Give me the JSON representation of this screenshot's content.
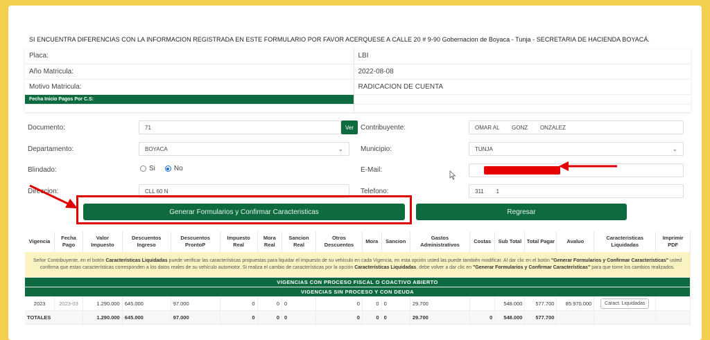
{
  "notice": "SI ENCUENTRA DIFERENCIAS CON LA INFORMACION REGISTRADA EN ESTE FORMULARIO POR FAVOR ACERQUESE A CALLE 20 # 9-90 Gobernacion de Boyaca - Tunja - SECRETARIA DE HACIENDA BOYACÁ.",
  "info": {
    "placa_label": "Placa:",
    "placa_value": "LBI",
    "anio_label": "Año Matricula:",
    "anio_value": "2022-08-08",
    "motivo_label": "Motivo Matricula:",
    "motivo_value": "RADICACION DE CUENTA",
    "fecha_label": "Fecha Inicio Pagos Por C.S:"
  },
  "form": {
    "documento_label": "Documento:",
    "documento_value": "71",
    "ver_label": "Ver",
    "contribuyente_label": "Contribuyente:",
    "contribuyente_value": "OMAR AL        GONZ        ONZALEZ",
    "departamento_label": "Departamento:",
    "departamento_value": "BOYACA",
    "municipio_label": "Municipio:",
    "municipio_value": "TUNJA",
    "blindado_label": "Blindado:",
    "si_label": "Si",
    "no_label": "No",
    "email_label": "E-Mail:",
    "direccion_label": "Direccion:",
    "direccion_value": "CLL 60 N",
    "telefono_label": "Telefono:",
    "telefono_value": "311        1"
  },
  "buttons": {
    "generar": "Generar Formularios y Confirmar Caracteristicas",
    "regresar": "Regresar"
  },
  "table": {
    "headers": [
      "Vigencia",
      "Fecha Pago",
      "Valor Impuesto",
      "Descuentos Ingreso",
      "Descuentos ProntoP",
      "Impuesto Real",
      "Mora Real",
      "Sancion Real",
      "Otros Descuentos",
      "Mora",
      "Sancion",
      "Gastos Administrativos",
      "Costas",
      "Sub Total",
      "Total Pagar",
      "Avaluo",
      "Caracteristicas Liquidadas",
      "Imprimir PDF"
    ],
    "warn_1": "Señor Contribuyente, en el botón ",
    "warn_b1": "Características Liquidadas",
    "warn_2": " puede verificar las características propuestas para liquidar el impuesto de su vehículo en cada Vigencia, en esta opción usted las puede también modificar. Al dar clic en el botón ",
    "warn_b2": "\"Generar Formularios y Confirmar Características\"",
    "warn_3": " usted confirma que estas características corresponden a los datos reales de su vehículo automotor. Si realiza el cambio de características por la opción ",
    "warn_b3": "Características Liquidadas",
    "warn_4": ", debe volver a dar clic en ",
    "warn_b4": "\"Generar Formularios y Confirmar Características\"",
    "warn_5": " para que tome los cambios realizados.",
    "band_1": "VIGENCIAS CON PROCESO FISCAL O COACTIVO ABIERTO",
    "band_2": "VIGENCIAS SIN PROCESO Y CON DEUDA",
    "row": {
      "vigencia": "2023",
      "fecha": "2023-03",
      "valor": "1.290.000",
      "desc_ing": "645.000",
      "desc_pronto": "97.000",
      "imp_real": "0",
      "mora_real": "0",
      "sancion_real": "0",
      "otros": "0",
      "mora": "0",
      "sancion": "0",
      "gastos": "29.700",
      "costas": "",
      "subtotal": "548.000",
      "total": "577.700",
      "avaluo": "85.970.000",
      "liq_btn": "Caract. Liquidadas"
    },
    "totals": {
      "label": "TOTALES",
      "valor": "1.290.000",
      "desc_ing": "645.000",
      "desc_pronto": "97.000",
      "imp_real": "0",
      "mora_real": "0",
      "sancion_real": "0",
      "otros": "0",
      "mora": "0",
      "sancion": "0",
      "gastos": "29.700",
      "costas": "0",
      "subtotal": "548.000",
      "total": "577.700"
    }
  },
  "colors": {
    "accent_green": "#0d6b3f",
    "background_yellow": "#f2cf4f",
    "annotation_red": "#e00000"
  }
}
